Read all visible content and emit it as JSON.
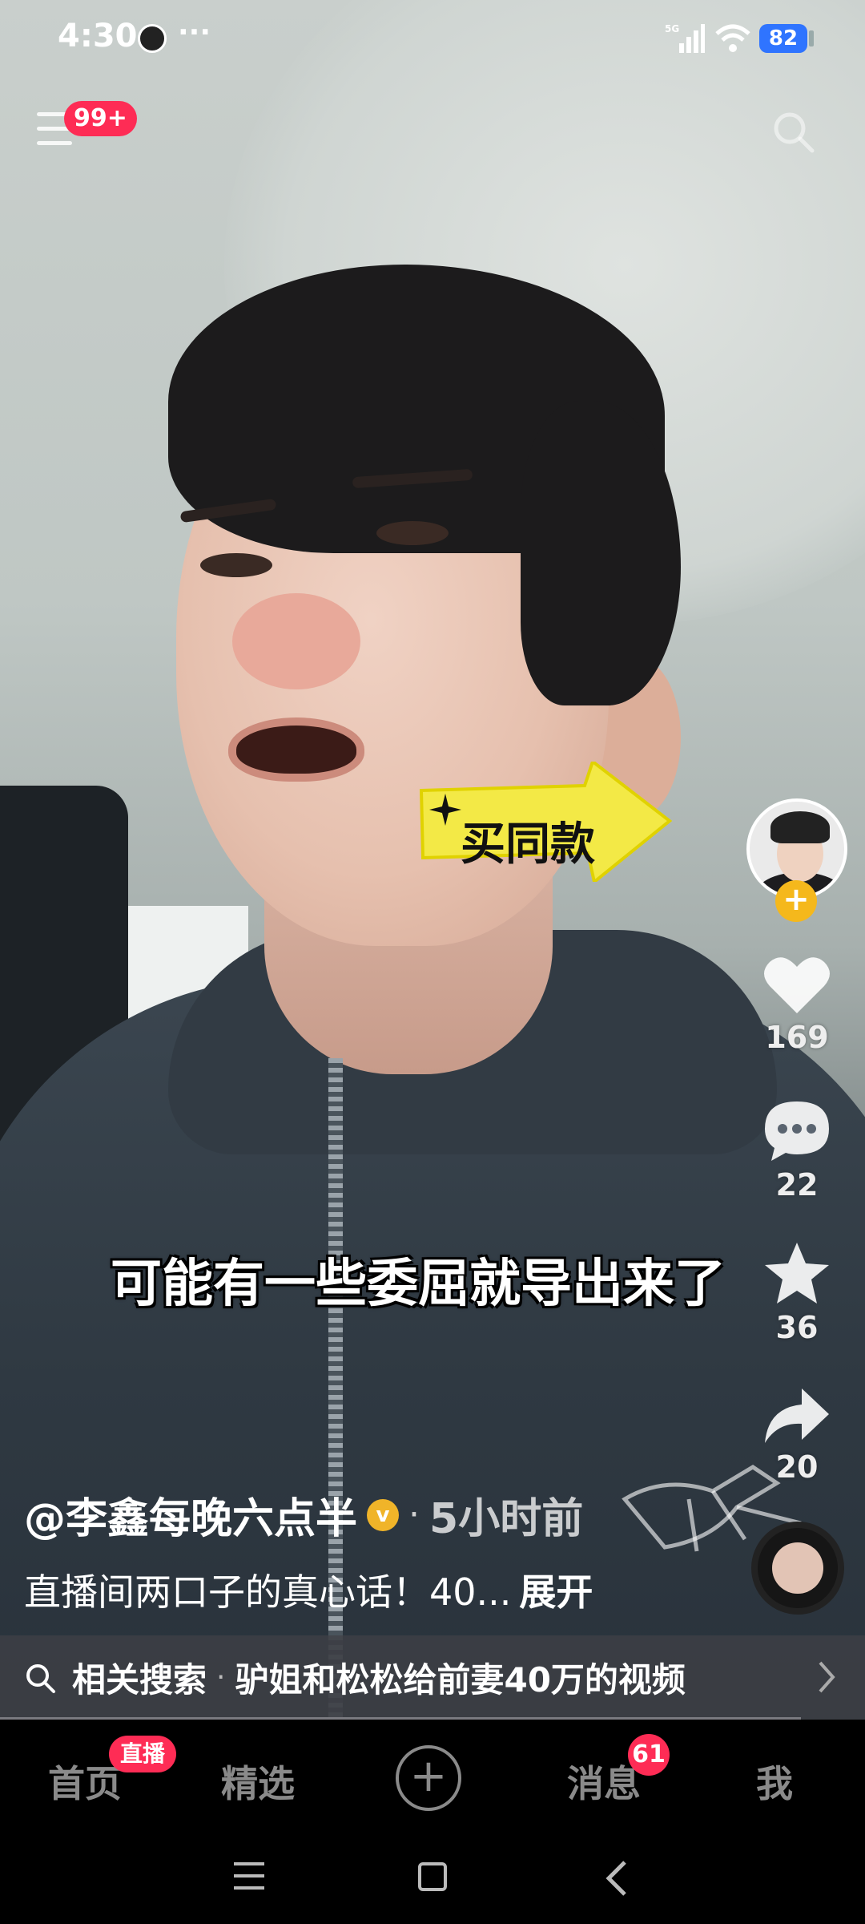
{
  "status_bar": {
    "time": "4:30",
    "more": "···",
    "network": "5G",
    "battery": "82"
  },
  "top": {
    "menu_badge": "99+"
  },
  "video": {
    "sticker_text": "买同款",
    "caption": "可能有一些委屈就导出来了"
  },
  "actions": {
    "likes": "169",
    "comments": "22",
    "favorites": "36",
    "shares": "20",
    "follow_symbol": "+"
  },
  "post": {
    "author": "@李鑫每晚六点半",
    "verified_symbol": "v",
    "separator": "·",
    "time_ago": "5小时前",
    "description": "直播间两口子的真心话！40...",
    "expand": "展开"
  },
  "related": {
    "label": "相关搜索",
    "separator": "·",
    "query": "驴姐和松松给前妻40万的视频"
  },
  "bottom_nav": {
    "home": "首页",
    "live_badge": "直播",
    "featured": "精选",
    "add": "+",
    "messages": "消息",
    "messages_badge": "61",
    "me": "我"
  },
  "colors": {
    "accent_red": "#fe2c55",
    "sticker_yellow": "#f3e946",
    "verified_gold": "#f0b429",
    "battery_blue": "#2f74ff"
  }
}
